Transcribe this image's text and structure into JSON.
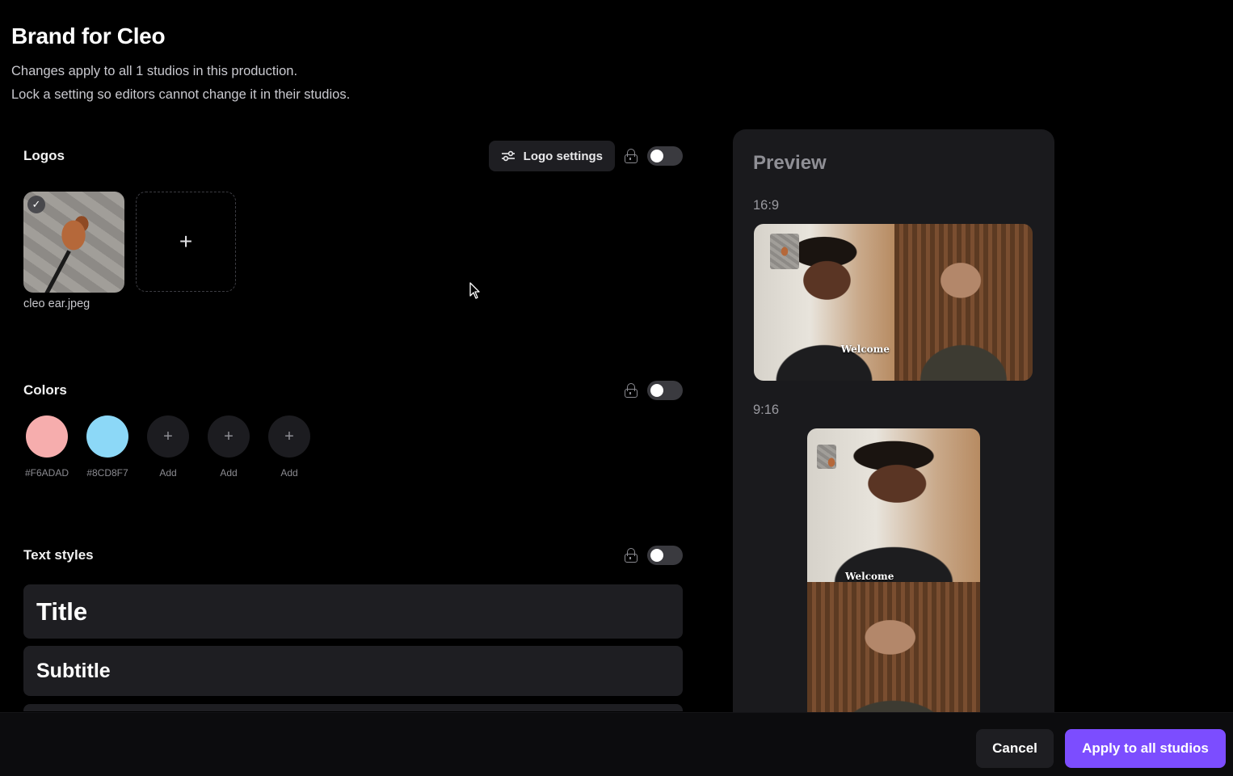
{
  "header": {
    "title": "Brand for Cleo",
    "subtitle_line1": "Changes apply to all 1 studios in this production.",
    "subtitle_line2": "Lock a setting so editors cannot change it in their studios."
  },
  "logos": {
    "section_title": "Logos",
    "settings_button_label": "Logo settings",
    "settings_icon": "sliders-icon",
    "lock_icon": "lock-icon",
    "locked": false,
    "items": [
      {
        "filename": "cleo ear.jpeg",
        "selected": true,
        "check_icon": "check-icon"
      }
    ],
    "add_icon": "plus-icon"
  },
  "colors": {
    "section_title": "Colors",
    "lock_icon": "lock-icon",
    "locked": false,
    "swatches": [
      {
        "label": "#F6ADAD",
        "hex": "#F6ADAD"
      },
      {
        "label": "#8CD8F7",
        "hex": "#8CD8F7"
      }
    ],
    "add_slots": [
      {
        "label": "Add"
      },
      {
        "label": "Add"
      },
      {
        "label": "Add"
      }
    ]
  },
  "text_styles": {
    "section_title": "Text styles",
    "lock_icon": "lock-icon",
    "locked": false,
    "items": [
      {
        "label": "Title"
      },
      {
        "label": "Subtitle"
      }
    ]
  },
  "preview": {
    "title": "Preview",
    "ratio_169": "16:9",
    "ratio_916": "9:16",
    "caption": "Welcome"
  },
  "footer": {
    "cancel_label": "Cancel",
    "apply_label": "Apply to all studios"
  },
  "colors_accent": {
    "primary_button": "#7C4DFF",
    "background": "#000000",
    "panel": "#1A1A1D"
  }
}
